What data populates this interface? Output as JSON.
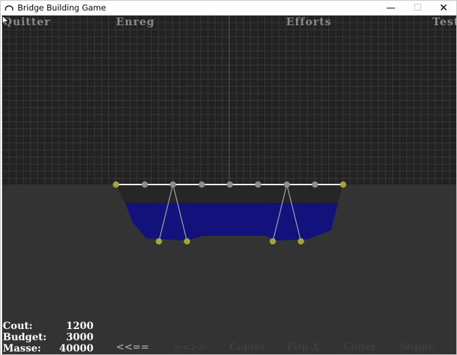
{
  "window": {
    "title": "Bridge Building Game",
    "minimize_glyph": "—",
    "maximize_glyph": "☐",
    "close_glyph": "✕"
  },
  "menu": {
    "quit": "Quitter",
    "save": "Enreg",
    "stress": "Efforts",
    "test": "Test"
  },
  "stats": {
    "cost_label": "Cout:",
    "cost_value": "1200",
    "budget_label": "Budget:",
    "budget_value": "3000",
    "mass_label": "Masse:",
    "mass_value": "40000"
  },
  "toolbar": {
    "undo": "<<==",
    "redo": "==>>",
    "copy": "Copier",
    "flip_x": "Flip X",
    "paste": "Coller",
    "delete": "Suppr."
  },
  "colors": {
    "sky": "#222222",
    "grid": "#3a3a3a",
    "ground": "#333333",
    "water": "#13117c",
    "anchor": "#a6a33c",
    "joint": "#8d8d8d",
    "road": "#ffffff",
    "beam": "#a8a8a8"
  },
  "icons": {
    "app": "bridge-icon",
    "cursor": "mouse-pointer-icon"
  }
}
